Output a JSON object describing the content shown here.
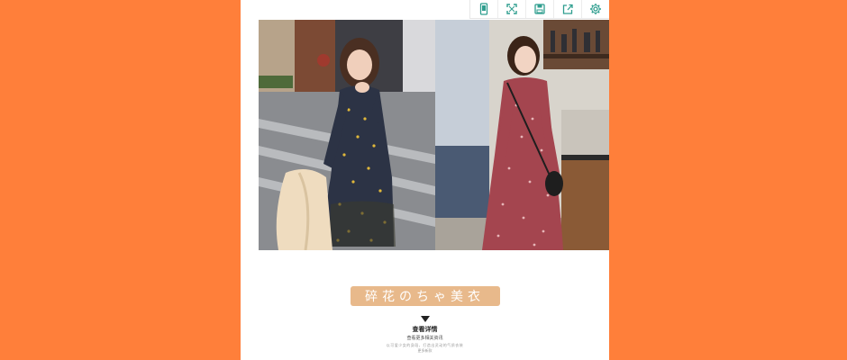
{
  "toolbar": {
    "icons": [
      "phone-icon",
      "fullscreen-icon",
      "save-icon",
      "share-icon",
      "settings-icon"
    ],
    "icon_color": "#2f9e8f"
  },
  "photos": [
    {
      "name": "model-left",
      "dress_color": "#2c3345"
    },
    {
      "name": "model-right",
      "dress_color": "#a4454f"
    }
  ],
  "caption": {
    "title": "碎花のちゃ美衣",
    "pill_color": "#e8b98b",
    "heading": "查看详情",
    "subheading": "查看更多相关资讯",
    "fine_print": "以可爱少女的身段，打造出灵动的气质衣装",
    "fine_print_2": "更多新款"
  },
  "page": {
    "background_color": "#ff7f3a"
  }
}
